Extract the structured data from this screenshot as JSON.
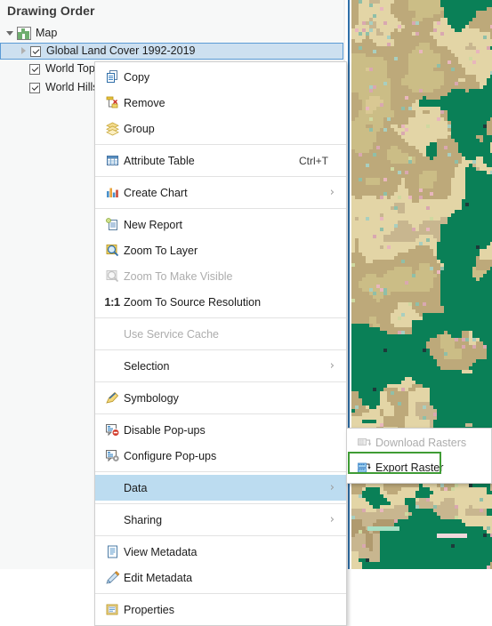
{
  "pane": {
    "title": "Drawing Order",
    "tree": [
      {
        "label": "Map",
        "level": 0,
        "twisty": "down",
        "icon": "map-icon",
        "checkbox": false,
        "selected": false
      },
      {
        "label": "Global Land Cover 1992-2019",
        "level": 1,
        "twisty": "right",
        "icon": "checkbox",
        "checkbox": true,
        "selected": true
      },
      {
        "label": "World Topographic Map",
        "level": 1,
        "twisty": "empty",
        "icon": "checkbox",
        "checkbox": true,
        "selected": false
      },
      {
        "label": "World Hillshade",
        "level": 1,
        "twisty": "empty",
        "icon": "checkbox",
        "checkbox": true,
        "selected": false
      }
    ]
  },
  "context_menu": {
    "items": [
      {
        "label": "Copy",
        "icon": "copy-icon",
        "accel": "",
        "arrow": false,
        "disabled": false,
        "highlight": false,
        "separator_before": false
      },
      {
        "label": "Remove",
        "icon": "remove-icon",
        "accel": "",
        "arrow": false,
        "disabled": false,
        "highlight": false,
        "separator_before": false
      },
      {
        "label": "Group",
        "icon": "group-icon",
        "accel": "",
        "arrow": false,
        "disabled": false,
        "highlight": false,
        "separator_before": false
      },
      {
        "label": "Attribute Table",
        "icon": "table-icon",
        "accel": "Ctrl+T",
        "arrow": false,
        "disabled": false,
        "highlight": false,
        "separator_before": true
      },
      {
        "label": "Create Chart",
        "icon": "chart-icon",
        "accel": "",
        "arrow": true,
        "disabled": false,
        "highlight": false,
        "separator_before": true
      },
      {
        "label": "New Report",
        "icon": "report-icon",
        "accel": "",
        "arrow": false,
        "disabled": false,
        "highlight": false,
        "separator_before": true
      },
      {
        "label": "Zoom To Layer",
        "icon": "zoom-layer-icon",
        "accel": "",
        "arrow": false,
        "disabled": false,
        "highlight": false,
        "separator_before": false
      },
      {
        "label": "Zoom To Make Visible",
        "icon": "zoom-visible-icon",
        "accel": "",
        "arrow": false,
        "disabled": true,
        "highlight": false,
        "separator_before": false
      },
      {
        "label": "Zoom To Source Resolution",
        "icon": "one-to-one-icon",
        "accel": "",
        "arrow": false,
        "disabled": false,
        "highlight": false,
        "separator_before": false
      },
      {
        "label": "Use Service Cache",
        "icon": "none",
        "accel": "",
        "arrow": false,
        "disabled": true,
        "highlight": false,
        "separator_before": true
      },
      {
        "label": "Selection",
        "icon": "none",
        "accel": "",
        "arrow": true,
        "disabled": false,
        "highlight": false,
        "separator_before": true
      },
      {
        "label": "Symbology",
        "icon": "symbology-icon",
        "accel": "",
        "arrow": false,
        "disabled": false,
        "highlight": false,
        "separator_before": true
      },
      {
        "label": "Disable Pop-ups",
        "icon": "disable-popup-icon",
        "accel": "",
        "arrow": false,
        "disabled": false,
        "highlight": false,
        "separator_before": true
      },
      {
        "label": "Configure Pop-ups",
        "icon": "configure-popup-icon",
        "accel": "",
        "arrow": false,
        "disabled": false,
        "highlight": false,
        "separator_before": false
      },
      {
        "label": "Data",
        "icon": "none",
        "accel": "",
        "arrow": true,
        "disabled": false,
        "highlight": true,
        "separator_before": true
      },
      {
        "label": "Sharing",
        "icon": "none",
        "accel": "",
        "arrow": true,
        "disabled": false,
        "highlight": false,
        "separator_before": true
      },
      {
        "label": "View Metadata",
        "icon": "view-metadata-icon",
        "accel": "",
        "arrow": false,
        "disabled": false,
        "highlight": false,
        "separator_before": true
      },
      {
        "label": "Edit Metadata",
        "icon": "edit-metadata-icon",
        "accel": "",
        "arrow": false,
        "disabled": false,
        "highlight": false,
        "separator_before": false
      },
      {
        "label": "Properties",
        "icon": "properties-icon",
        "accel": "",
        "arrow": false,
        "disabled": false,
        "highlight": false,
        "separator_before": true
      }
    ]
  },
  "sub_menu": {
    "items": [
      {
        "label": "Download Rasters",
        "icon": "download-raster-icon",
        "disabled": true,
        "outlined": false
      },
      {
        "label": "Export Raster",
        "icon": "export-raster-icon",
        "disabled": false,
        "outlined": true
      }
    ]
  },
  "colors": {
    "selection_blue": "#cde0f0",
    "selection_border": "#5b9bd5",
    "menu_highlight": "#bcdcf0",
    "callout_green": "#3f9c35",
    "map_water": "#0a8057",
    "map_land": "#d9c893"
  }
}
